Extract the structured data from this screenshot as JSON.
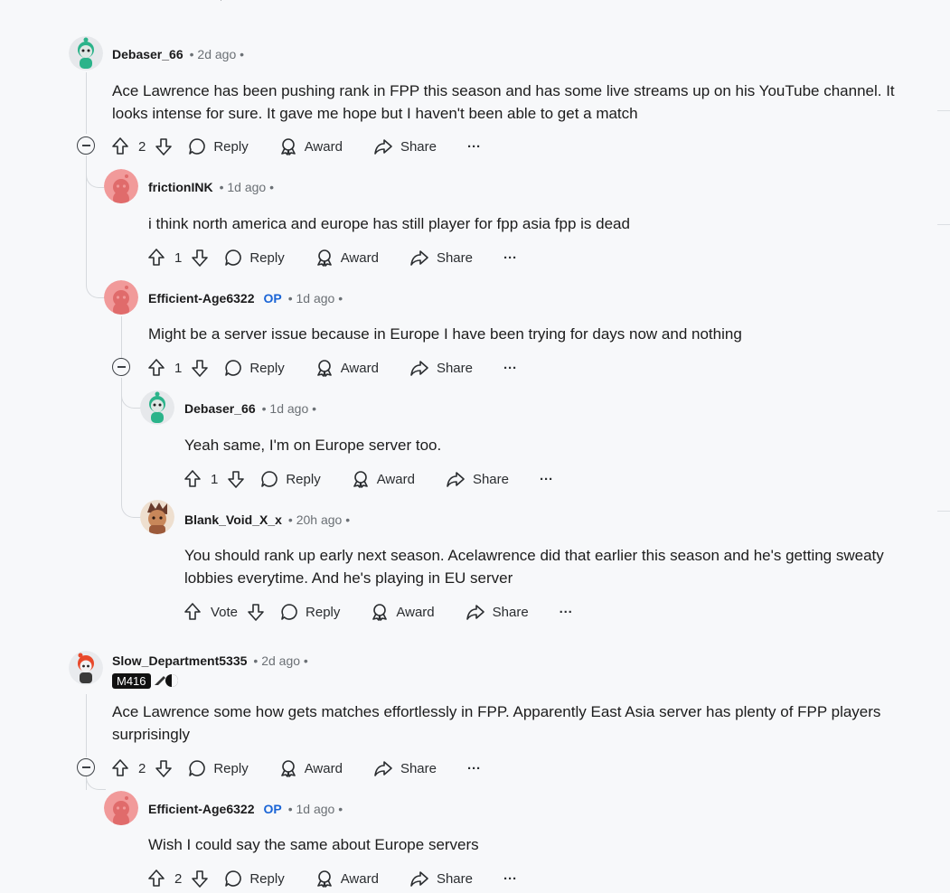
{
  "comments": [
    {
      "author": "Debaser_66",
      "op": "",
      "time": "• 2d ago •",
      "body": "Ace Lawrence has been pushing rank in FPP this season and has some live streams up on his YouTube channel. It looks intense for sure. It gave me hope but I haven't been able to get a match",
      "score": "2"
    },
    {
      "author": "frictionINK",
      "op": "",
      "time": "• 1d ago •",
      "body": "i think north america and europe has still player for fpp asia fpp is dead",
      "score": "1"
    },
    {
      "author": "Efficient-Age6322",
      "op": "OP",
      "time": "• 1d ago •",
      "body": "Might be a server issue because in Europe I have been trying for days now and nothing",
      "score": "1"
    },
    {
      "author": "Debaser_66",
      "op": "",
      "time": "• 1d ago •",
      "body": "Yeah same, I'm on Europe server too.",
      "score": "1"
    },
    {
      "author": "Blank_Void_X_x",
      "op": "",
      "time": "• 20h ago •",
      "body": "You should rank up early next season. Acelawrence did that earlier this season and he's getting sweaty lobbies everytime. And he's playing in EU server",
      "score": "Vote"
    },
    {
      "author": "Slow_Department5335",
      "op": "",
      "time": "• 2d ago •",
      "flair": "M416",
      "body": "Ace Lawrence some how gets matches effortlessly in FPP. Apparently East Asia server has plenty of FPP players surprisingly",
      "score": "2"
    },
    {
      "author": "Efficient-Age6322",
      "op": "OP",
      "time": "• 1d ago •",
      "body": "Wish I could say the same about Europe servers",
      "score": "2"
    }
  ],
  "labels": {
    "reply": "Reply",
    "award": "Award",
    "share": "Share",
    "more": "···"
  },
  "colors": {
    "background": "#f7f8fa",
    "op": "#1b65d6",
    "thread_line": "#d6d9dd"
  },
  "icons": [
    "upvote-icon",
    "downvote-icon",
    "reply-icon",
    "award-icon",
    "share-icon",
    "more-icon",
    "collapse-icon"
  ]
}
